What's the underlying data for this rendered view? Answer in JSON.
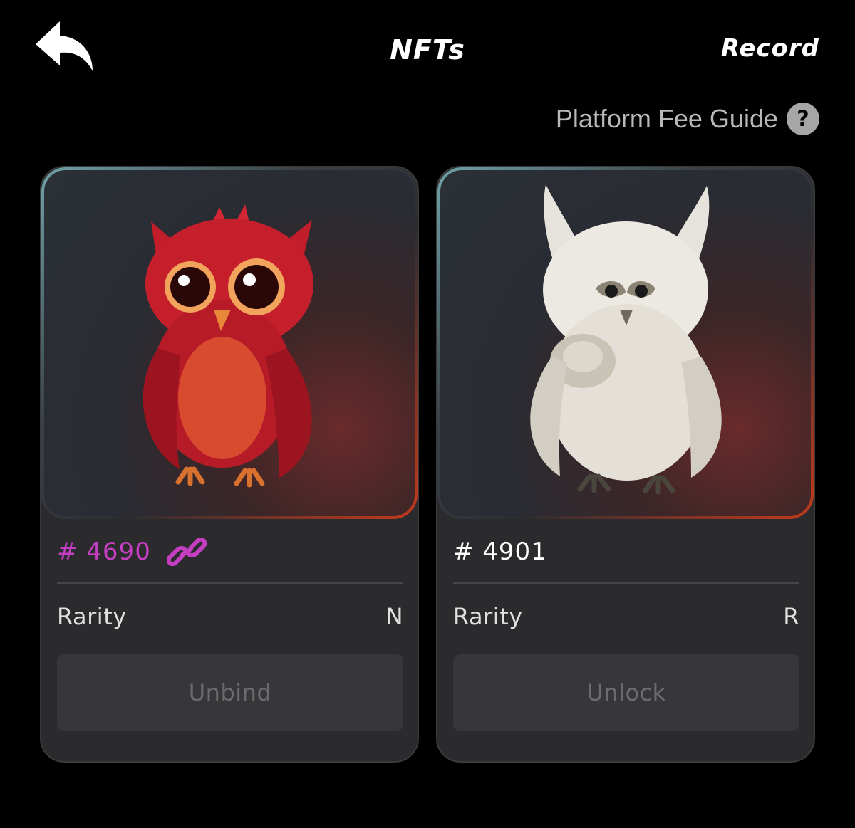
{
  "header": {
    "back_icon": "back-arrow-icon",
    "title": "NFTs",
    "record_label": "Record"
  },
  "fee_guide": {
    "label": "Platform Fee Guide",
    "help_icon": "question-mark-icon",
    "help_glyph": "?"
  },
  "cards": [
    {
      "image_subject": "red-owl",
      "token_id": "# 4690",
      "token_color": "#c33ec0",
      "link_icon": "chain-link-icon",
      "rarity_label": "Rarity",
      "rarity_value": "N",
      "action_label": "Unbind"
    },
    {
      "image_subject": "white-owl",
      "token_id": "# 4901",
      "rarity_label": "Rarity",
      "rarity_value": "R",
      "action_label": "Unlock"
    }
  ]
}
